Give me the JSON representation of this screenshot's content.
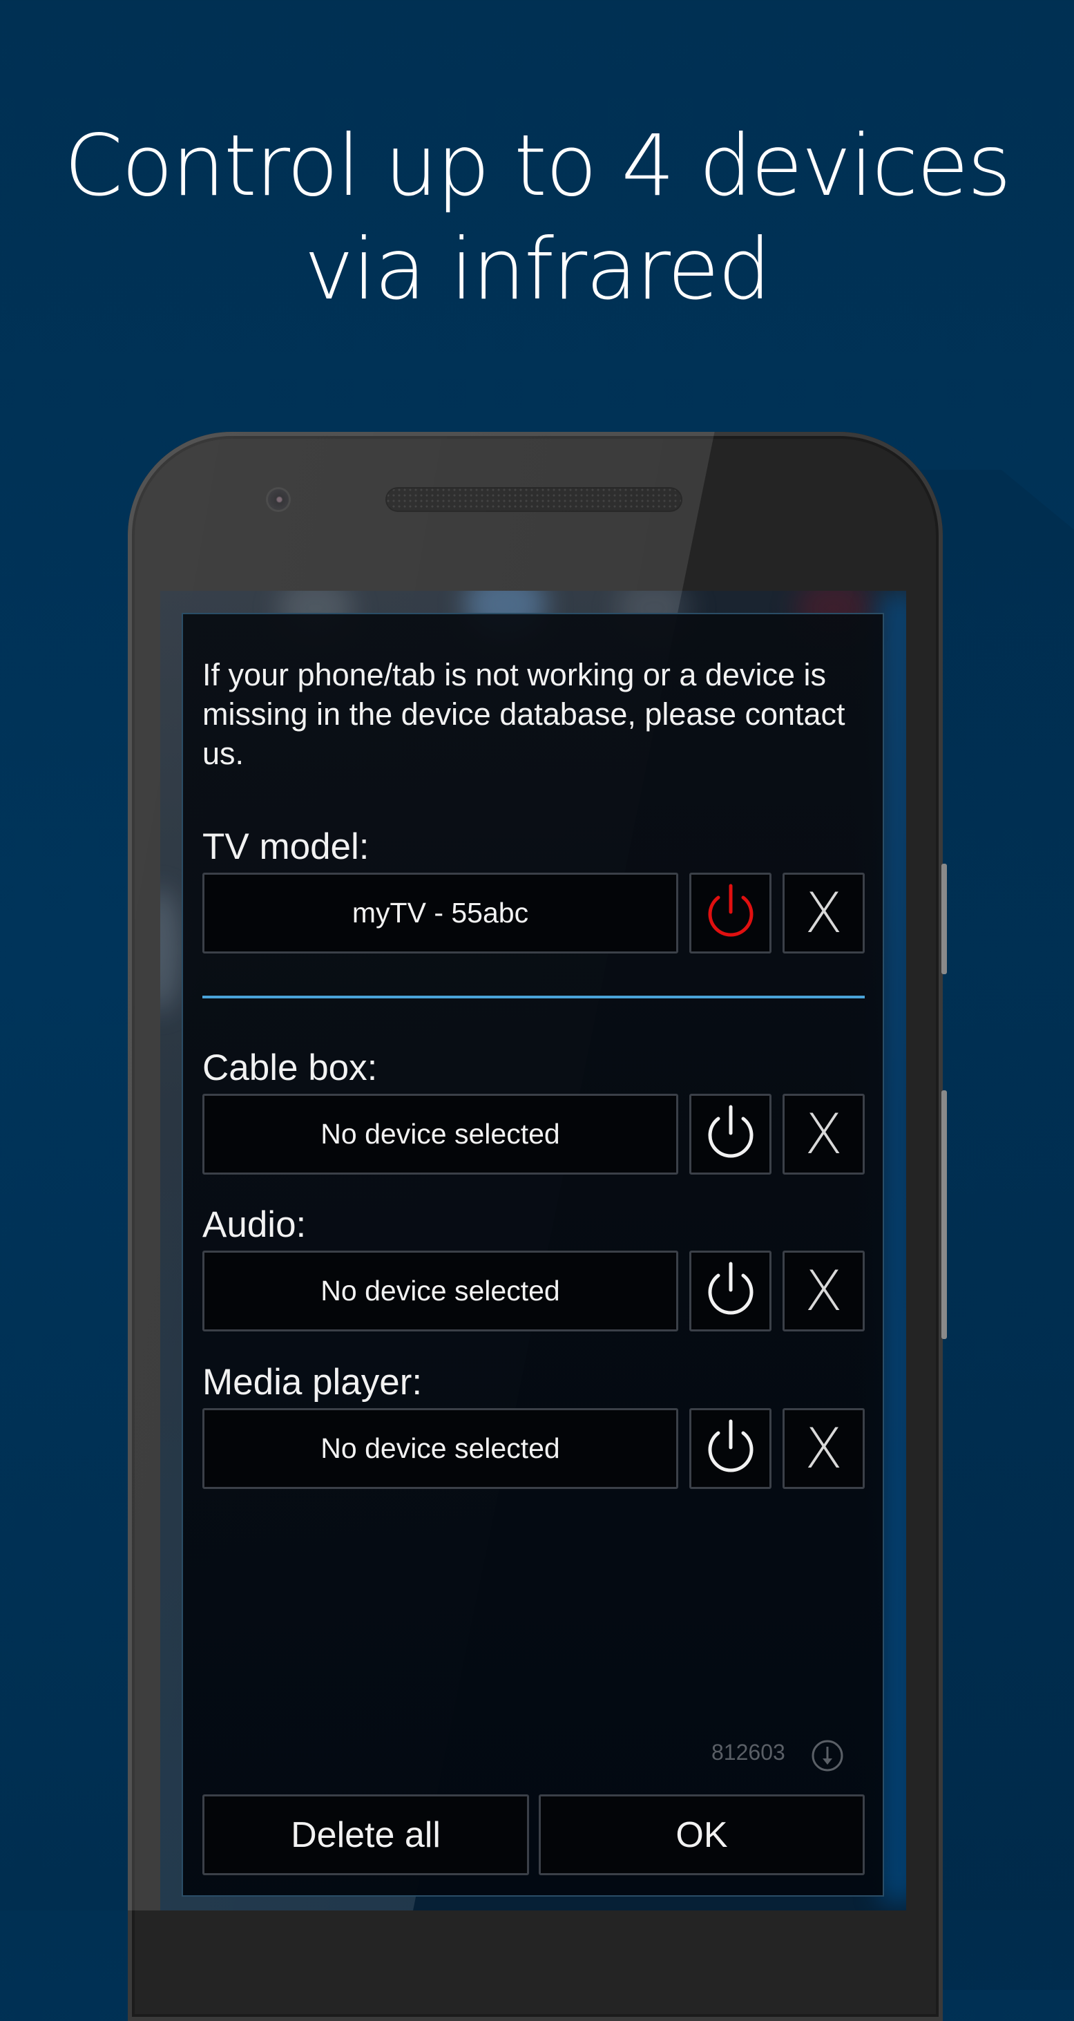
{
  "headline": {
    "line1": "Control up to 4 devices",
    "line2": "via infrared"
  },
  "dialog": {
    "message": "If your phone/tab is not working or a device is missing in the device database, please contact us.",
    "devices": [
      {
        "label": "TV model:",
        "value": "myTV - 55abc",
        "power_state": "on",
        "power_color": "#e01010"
      },
      {
        "label": "Cable box:",
        "value": "No device selected",
        "power_state": "off",
        "power_color": "#f2f2f2"
      },
      {
        "label": "Audio:",
        "value": "No device selected",
        "power_state": "off",
        "power_color": "#f2f2f2"
      },
      {
        "label": "Media player:",
        "value": "No device selected",
        "power_state": "off",
        "power_color": "#f2f2f2"
      }
    ],
    "clear_glyph": "X",
    "version": "812603",
    "delete_all_label": "Delete all",
    "ok_label": "OK"
  },
  "colors": {
    "background": "#003053",
    "accent_divider": "#4aa3d8",
    "power_on": "#e01010"
  }
}
